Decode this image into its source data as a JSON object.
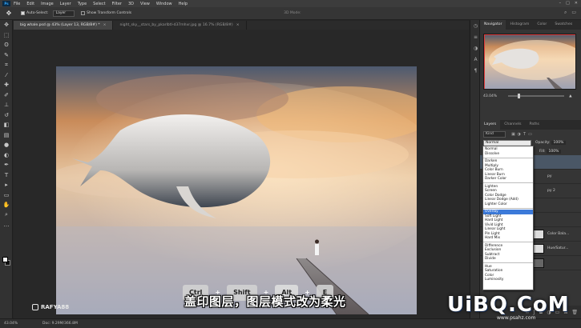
{
  "menubar": {
    "logo": "Ps",
    "items": [
      "File",
      "Edit",
      "Image",
      "Layer",
      "Type",
      "Select",
      "Filter",
      "3D",
      "View",
      "Window",
      "Help"
    ],
    "window_controls": [
      "–",
      "□",
      "✕"
    ]
  },
  "options_bar": {
    "auto_select_label": "Auto-Select:",
    "auto_select_target": "Layer",
    "transform_label": "Show Transform Controls",
    "mode_label": "3D Mode:"
  },
  "tabs": [
    {
      "label": "big whale.psd @ 43% (Layer 13, RGB/8#) *",
      "active": true
    },
    {
      "label": "night_sky__stars_by_pkarlbtl-d37mhvr.jpg @ 16.7% (RGB/8#)",
      "active": false
    }
  ],
  "navigator": {
    "tabs": [
      "Navigator",
      "Histogram",
      "Color",
      "Swatches"
    ],
    "zoom": "43.04%"
  },
  "layers_panel": {
    "tabs": [
      "Layers",
      "Channels",
      "Paths"
    ],
    "kind_label": "Kind",
    "blend_mode": "Normal",
    "opacity_label": "Opacity:",
    "opacity_value": "100%",
    "fill_label": "Fill:",
    "fill_value": "100%",
    "layer_names": [
      "py",
      "py 2",
      "Color Bala...",
      "Hue/Satur..."
    ]
  },
  "blend_modes": {
    "groups": [
      [
        "Normal",
        "Dissolve"
      ],
      [
        "Darken",
        "Multiply",
        "Color Burn",
        "Linear Burn",
        "Darker Color"
      ],
      [
        "Lighten",
        "Screen",
        "Color Dodge",
        "Linear Dodge (Add)",
        "Lighter Color"
      ],
      [
        "Overlay",
        "Soft Light",
        "Hard Light",
        "Vivid Light",
        "Linear Light",
        "Pin Light",
        "Hard Mix"
      ],
      [
        "Difference",
        "Exclusion",
        "Subtract",
        "Divide"
      ],
      [
        "Hue",
        "Saturation",
        "Color",
        "Luminosity"
      ]
    ],
    "highlighted": "Overlay"
  },
  "status": {
    "zoom": "43.04%",
    "doc": "Doc: 9.29M/366.8M"
  },
  "overlay": {
    "keys": [
      "Ctrl",
      "Shift",
      "Alt",
      "E"
    ],
    "caption": "盖印图层，图层模式改为柔光",
    "watermark": "RAFYA88",
    "logo": "UiBQ.CoM",
    "logo_sub": "www.psahz.com"
  },
  "colors": {
    "accent_highlight": "#3c7ad9",
    "ui_dark": "#353535",
    "nav_viewbox": "#e03a3a"
  }
}
